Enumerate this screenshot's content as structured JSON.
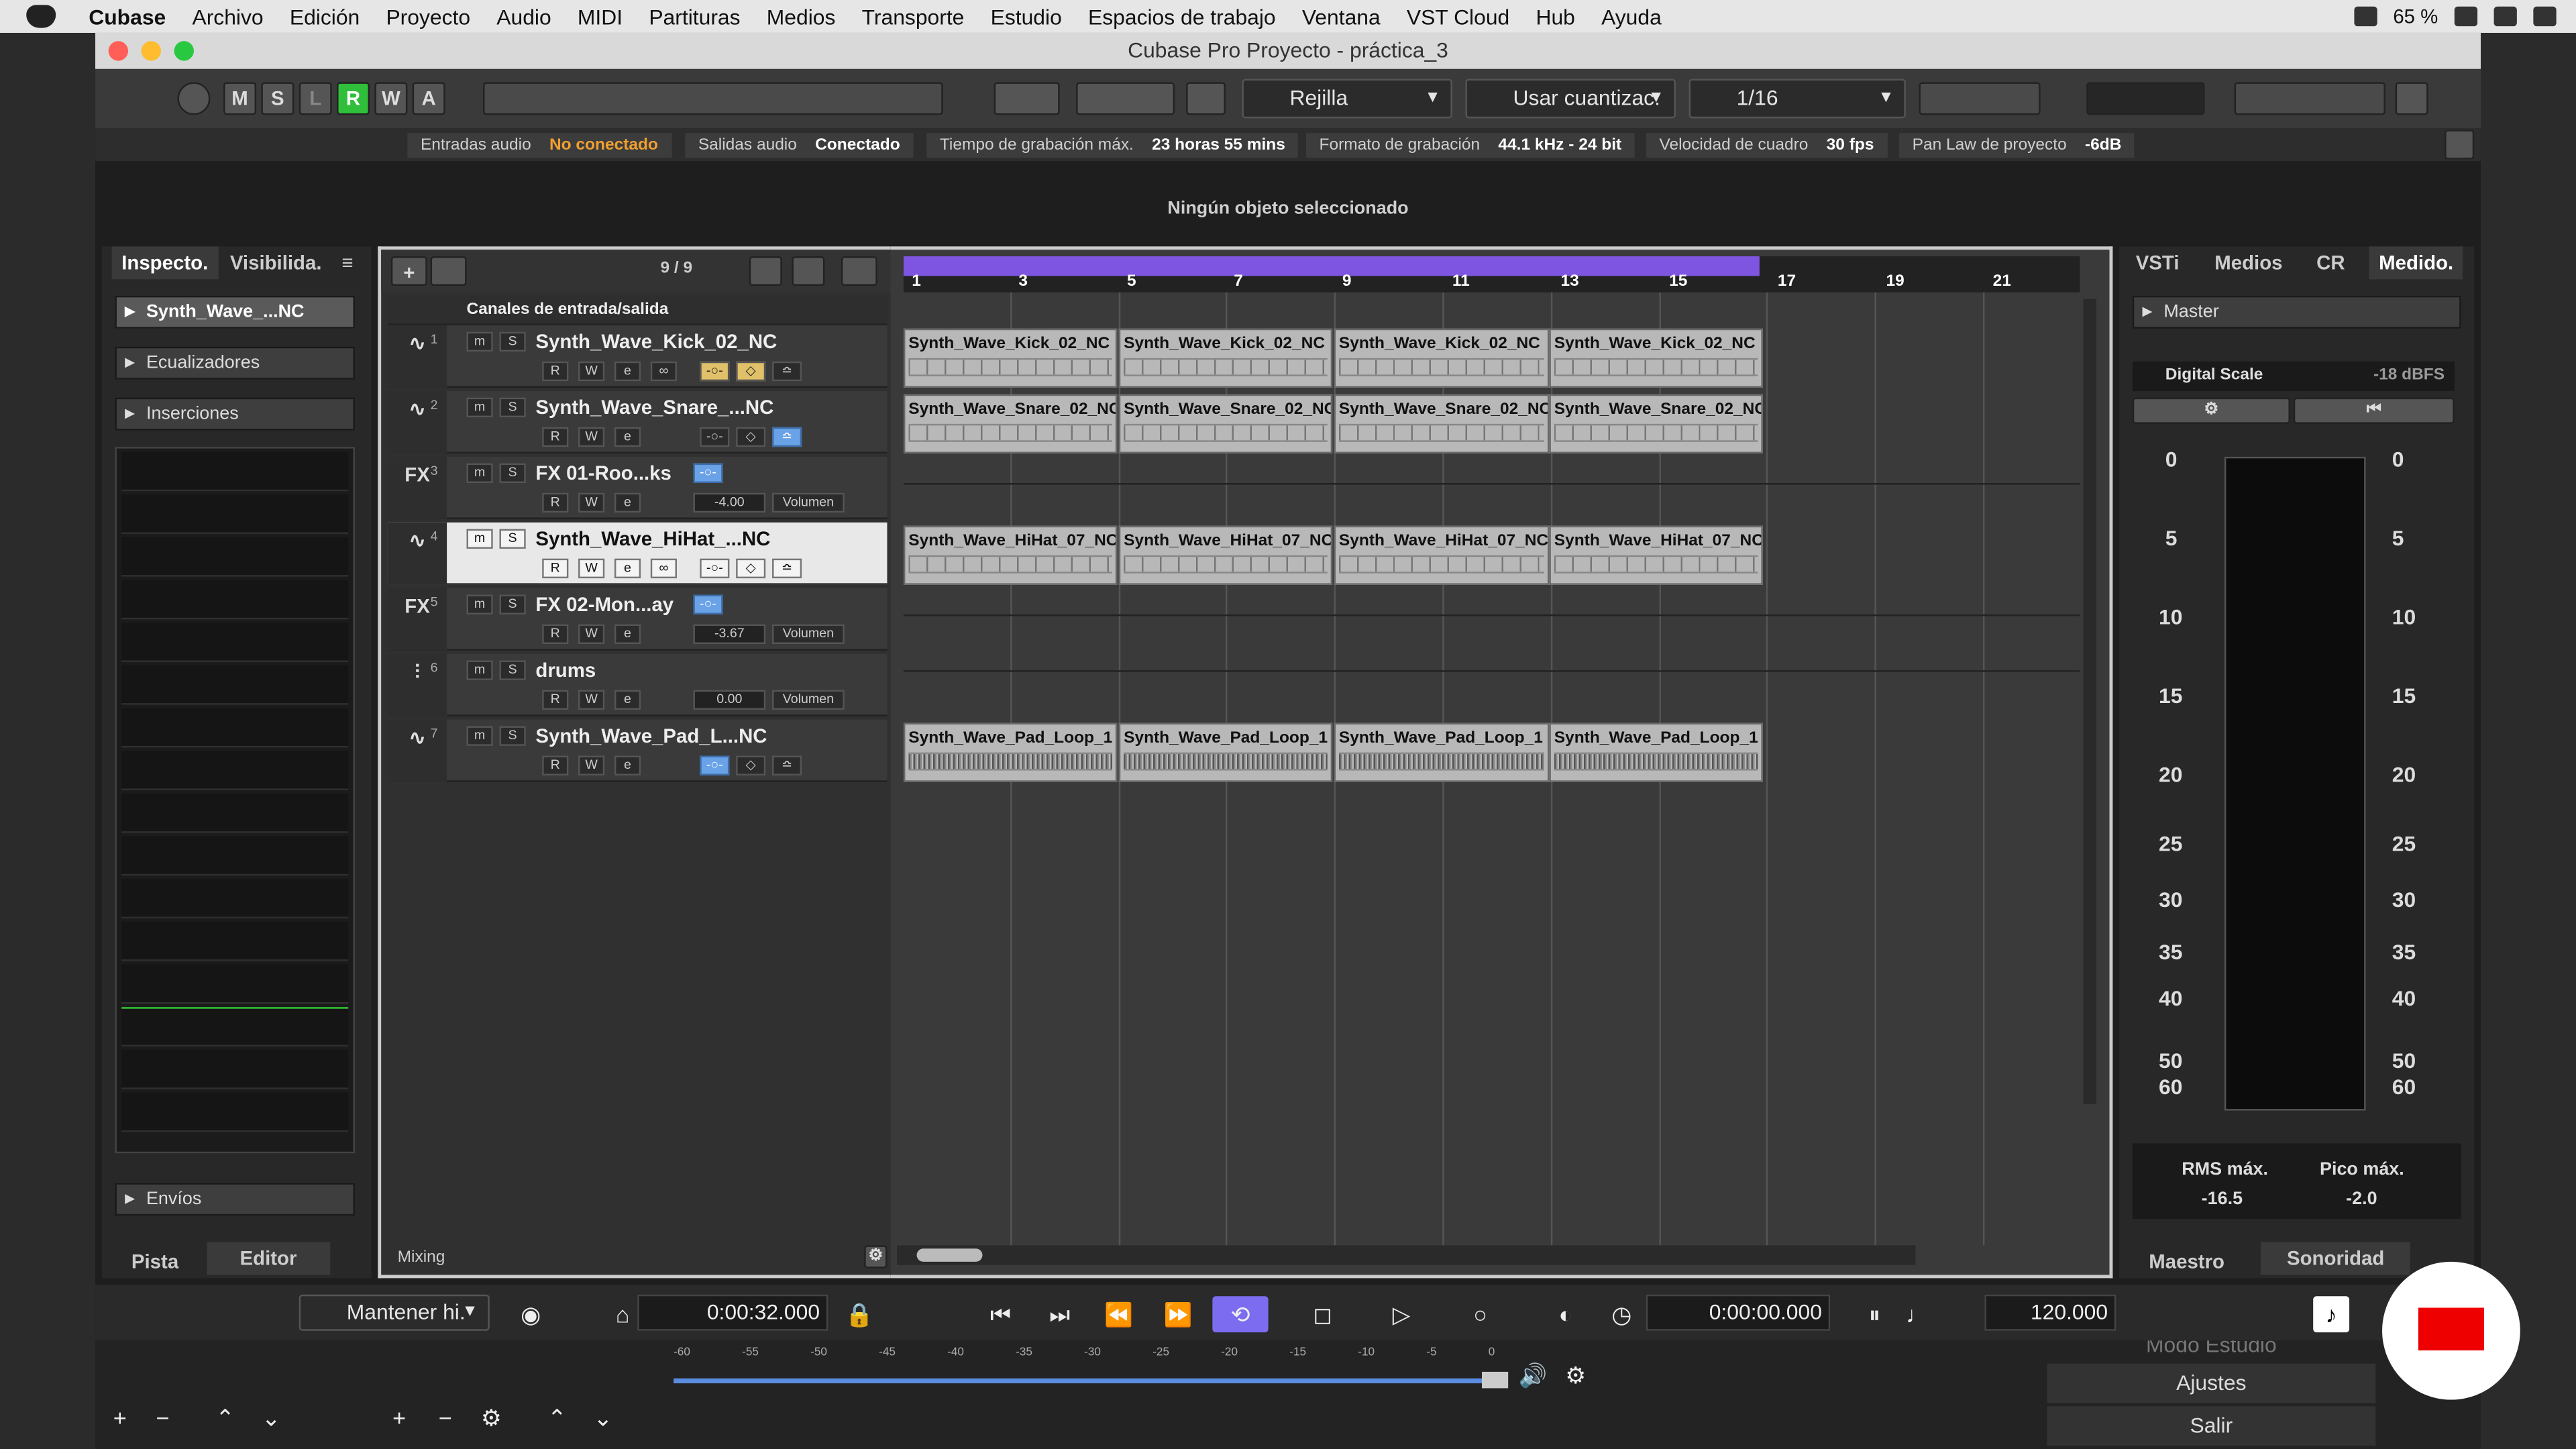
{
  "menubar": {
    "app": "Cubase",
    "items": [
      "Archivo",
      "Edición",
      "Proyecto",
      "Audio",
      "MIDI",
      "Partituras",
      "Medios",
      "Transporte",
      "Estudio",
      "Espacios de trabajo",
      "Ventana",
      "VST Cloud",
      "Hub",
      "Ayuda"
    ],
    "battery": "65 %"
  },
  "window": {
    "title": "Cubase Pro Proyecto - práctica_3"
  },
  "toolbar": {
    "mode_buttons": [
      "M",
      "S",
      "L",
      "R",
      "W",
      "A"
    ],
    "grid_mode": "Rejilla",
    "quantize_mode": "Usar cuantizac.",
    "quantize_value": "1/16"
  },
  "status": {
    "in_label": "Entradas audio",
    "in_value": "No conectado",
    "out_label": "Salidas audio",
    "out_value": "Conectado",
    "rec_time_label": "Tiempo de grabación máx.",
    "rec_time_value": "23 horas 55 mins",
    "rec_format_label": "Formato de grabación",
    "rec_format_value": "44.1 kHz - 24 bit",
    "frame_label": "Velocidad de cuadro",
    "frame_value": "30 fps",
    "pan_label": "Pan Law de proyecto",
    "pan_value": "-6dB"
  },
  "info_line": "Ningún objeto seleccionado",
  "inspector": {
    "tabs": [
      "Inspecto.",
      "Visibilida."
    ],
    "track_name": "Synth_Wave_...NC",
    "sections": {
      "eq": "Ecualizadores",
      "inserts": "Inserciones",
      "sends": "Envíos"
    },
    "bottom_tabs": [
      "Pista",
      "Editor"
    ]
  },
  "tracklist": {
    "count": "9 / 9",
    "folder": "Canales de entrada/salida",
    "footer": "Mixing",
    "tracks": [
      {
        "num": "1",
        "name": "Synth_Wave_Kick_02_NC",
        "type": "audio",
        "value": "",
        "label": ""
      },
      {
        "num": "2",
        "name": "Synth_Wave_Snare_...NC",
        "type": "audio",
        "value": "",
        "label": ""
      },
      {
        "num": "3",
        "name": "FX 01-Roo...ks",
        "type": "fx",
        "value": "-4.00",
        "label": "Volumen"
      },
      {
        "num": "4",
        "name": "Synth_Wave_HiHat_...NC",
        "type": "audio",
        "value": "",
        "label": ""
      },
      {
        "num": "5",
        "name": "FX 02-Mon...ay",
        "type": "fx",
        "value": "-3.67",
        "label": "Volumen"
      },
      {
        "num": "6",
        "name": "drums",
        "type": "group",
        "value": "0.00",
        "label": "Volumen"
      },
      {
        "num": "7",
        "name": "Synth_Wave_Pad_L...NC",
        "type": "audio",
        "value": "",
        "label": ""
      }
    ]
  },
  "ruler": {
    "bars": [
      "1",
      "3",
      "5",
      "7",
      "9",
      "11",
      "13",
      "15",
      "17",
      "19",
      "21"
    ]
  },
  "events": {
    "kick": "Synth_Wave_Kick_02_NC",
    "snare": "Synth_Wave_Snare_02_NC",
    "hihat": "Synth_Wave_HiHat_07_NC",
    "pad": "Synth_Wave_Pad_Loop_1"
  },
  "right_zone": {
    "tabs": [
      "VSTi",
      "Medios",
      "CR",
      "Medido."
    ],
    "master": "Master",
    "digital_scale": "Digital Scale",
    "dbfs": "-18 dBFS",
    "scale": [
      "0",
      "5",
      "10",
      "15",
      "20",
      "25",
      "30",
      "35",
      "40",
      "50",
      "60"
    ],
    "rms_label": "RMS máx.",
    "rms_value": "-16.5",
    "peak_label": "Pico máx.",
    "peak_value": "-2.0",
    "bottom_tabs": [
      "Maestro",
      "Sonoridad"
    ]
  },
  "transport": {
    "mode": "Mantener hi.",
    "position": "0:00:32.000",
    "time": "0:00:00.000",
    "tempo": "120.000"
  },
  "lower": {
    "menu": [
      "Modo Estudio",
      "Ajustes",
      "Salir"
    ],
    "fader_scale": [
      "-60",
      "-55",
      "-50",
      "-45",
      "-40",
      "-35",
      "-30",
      "-25",
      "-20",
      "-15",
      "-10",
      "-5",
      "0"
    ]
  }
}
